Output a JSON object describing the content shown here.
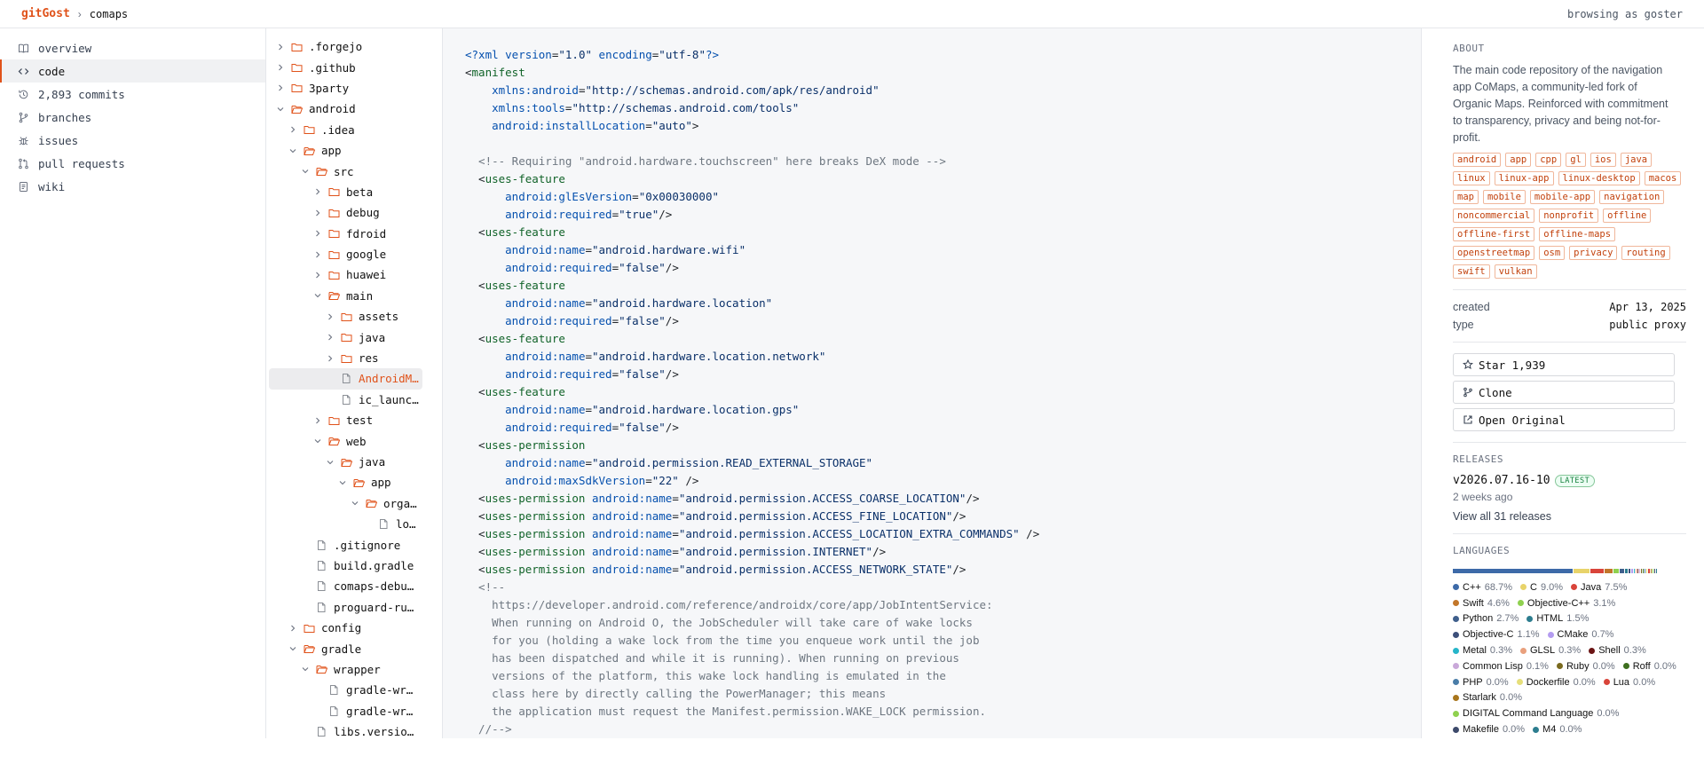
{
  "topbar": {
    "brand": "gitGost",
    "sep": "›",
    "repo": "comaps",
    "user": "browsing as goster"
  },
  "nav": [
    {
      "label": "overview",
      "icon": "book-icon"
    },
    {
      "label": "code",
      "icon": "code-icon",
      "active": true
    },
    {
      "label": "2,893 commits",
      "icon": "history-icon"
    },
    {
      "label": "branches",
      "icon": "branch-icon"
    },
    {
      "label": "issues",
      "icon": "bug-icon"
    },
    {
      "label": "pull requests",
      "icon": "pull-request-icon"
    },
    {
      "label": "wiki",
      "icon": "wiki-icon"
    }
  ],
  "tree": [
    {
      "name": ".forgejo",
      "type": "folder",
      "open": false,
      "depth": 0
    },
    {
      "name": ".github",
      "type": "folder",
      "open": false,
      "depth": 0
    },
    {
      "name": "3party",
      "type": "folder",
      "open": false,
      "depth": 0
    },
    {
      "name": "android",
      "type": "folder",
      "open": true,
      "depth": 0
    },
    {
      "name": ".idea",
      "type": "folder",
      "open": false,
      "depth": 1
    },
    {
      "name": "app",
      "type": "folder",
      "open": true,
      "depth": 1
    },
    {
      "name": "src",
      "type": "folder",
      "open": true,
      "depth": 2
    },
    {
      "name": "beta",
      "type": "folder",
      "open": false,
      "depth": 3
    },
    {
      "name": "debug",
      "type": "folder",
      "open": false,
      "depth": 3
    },
    {
      "name": "fdroid",
      "type": "folder",
      "open": false,
      "depth": 3
    },
    {
      "name": "google",
      "type": "folder",
      "open": false,
      "depth": 3
    },
    {
      "name": "huawei",
      "type": "folder",
      "open": false,
      "depth": 3
    },
    {
      "name": "main",
      "type": "folder",
      "open": true,
      "depth": 3
    },
    {
      "name": "assets",
      "type": "folder",
      "open": false,
      "depth": 4
    },
    {
      "name": "java",
      "type": "folder",
      "open": false,
      "depth": 4
    },
    {
      "name": "res",
      "type": "folder",
      "open": false,
      "depth": 4
    },
    {
      "name": "AndroidM…",
      "type": "file",
      "depth": 4,
      "selected": true
    },
    {
      "name": "ic_launc…",
      "type": "file",
      "depth": 4
    },
    {
      "name": "test",
      "type": "folder",
      "open": false,
      "depth": 3
    },
    {
      "name": "web",
      "type": "folder",
      "open": true,
      "depth": 3
    },
    {
      "name": "java",
      "type": "folder",
      "open": true,
      "depth": 4
    },
    {
      "name": "app",
      "type": "folder",
      "open": true,
      "depth": 5
    },
    {
      "name": "orga…",
      "type": "folder",
      "open": true,
      "depth": 6
    },
    {
      "name": "lo…",
      "type": "file",
      "depth": 7
    },
    {
      "name": ".gitignore",
      "type": "file",
      "depth": 2
    },
    {
      "name": "build.gradle",
      "type": "file",
      "depth": 2
    },
    {
      "name": "comaps-debu…",
      "type": "file",
      "depth": 2
    },
    {
      "name": "proguard-ru…",
      "type": "file",
      "depth": 2
    },
    {
      "name": "config",
      "type": "folder",
      "open": false,
      "depth": 1
    },
    {
      "name": "gradle",
      "type": "folder",
      "open": true,
      "depth": 1
    },
    {
      "name": "wrapper",
      "type": "folder",
      "open": true,
      "depth": 2
    },
    {
      "name": "gradle-wr…",
      "type": "file",
      "depth": 3
    },
    {
      "name": "gradle-wr…",
      "type": "file",
      "depth": 3
    },
    {
      "name": "libs.versio…",
      "type": "file",
      "depth": 2
    }
  ],
  "code": [
    [
      [
        "pi",
        "<?xml "
      ],
      [
        "attr",
        "version"
      ],
      [
        "",
        "="
      ],
      [
        "str",
        "\"1.0\""
      ],
      [
        "",
        " "
      ],
      [
        "attr",
        "encoding"
      ],
      [
        "",
        "="
      ],
      [
        "str",
        "\"utf-8\""
      ],
      [
        "pi",
        "?>"
      ]
    ],
    [
      [
        "",
        "<"
      ],
      [
        "tag",
        "manifest"
      ]
    ],
    [
      [
        "",
        "    "
      ],
      [
        "attr",
        "xmlns:android"
      ],
      [
        "",
        "="
      ],
      [
        "str",
        "\"http://schemas.android.com/apk/res/android\""
      ]
    ],
    [
      [
        "",
        "    "
      ],
      [
        "attr",
        "xmlns:tools"
      ],
      [
        "",
        "="
      ],
      [
        "str",
        "\"http://schemas.android.com/tools\""
      ]
    ],
    [
      [
        "",
        "    "
      ],
      [
        "attr",
        "android:installLocation"
      ],
      [
        "",
        "="
      ],
      [
        "str",
        "\"auto\""
      ],
      [
        "",
        ">"
      ]
    ],
    [
      [
        "",
        ""
      ]
    ],
    [
      [
        "com",
        "  <!-- Requiring \"android.hardware.touchscreen\" here breaks DeX mode -->"
      ]
    ],
    [
      [
        "",
        "  <"
      ],
      [
        "tag",
        "uses-feature"
      ]
    ],
    [
      [
        "",
        "      "
      ],
      [
        "attr",
        "android:glEsVersion"
      ],
      [
        "",
        "="
      ],
      [
        "str",
        "\"0x00030000\""
      ]
    ],
    [
      [
        "",
        "      "
      ],
      [
        "attr",
        "android:required"
      ],
      [
        "",
        "="
      ],
      [
        "str",
        "\"true\""
      ],
      [
        "",
        "/>"
      ]
    ],
    [
      [
        "",
        "  <"
      ],
      [
        "tag",
        "uses-feature"
      ]
    ],
    [
      [
        "",
        "      "
      ],
      [
        "attr",
        "android:name"
      ],
      [
        "",
        "="
      ],
      [
        "str",
        "\"android.hardware.wifi\""
      ]
    ],
    [
      [
        "",
        "      "
      ],
      [
        "attr",
        "android:required"
      ],
      [
        "",
        "="
      ],
      [
        "str",
        "\"false\""
      ],
      [
        "",
        "/>"
      ]
    ],
    [
      [
        "",
        "  <"
      ],
      [
        "tag",
        "uses-feature"
      ]
    ],
    [
      [
        "",
        "      "
      ],
      [
        "attr",
        "android:name"
      ],
      [
        "",
        "="
      ],
      [
        "str",
        "\"android.hardware.location\""
      ]
    ],
    [
      [
        "",
        "      "
      ],
      [
        "attr",
        "android:required"
      ],
      [
        "",
        "="
      ],
      [
        "str",
        "\"false\""
      ],
      [
        "",
        "/>"
      ]
    ],
    [
      [
        "",
        "  <"
      ],
      [
        "tag",
        "uses-feature"
      ]
    ],
    [
      [
        "",
        "      "
      ],
      [
        "attr",
        "android:name"
      ],
      [
        "",
        "="
      ],
      [
        "str",
        "\"android.hardware.location.network\""
      ]
    ],
    [
      [
        "",
        "      "
      ],
      [
        "attr",
        "android:required"
      ],
      [
        "",
        "="
      ],
      [
        "str",
        "\"false\""
      ],
      [
        "",
        "/>"
      ]
    ],
    [
      [
        "",
        "  <"
      ],
      [
        "tag",
        "uses-feature"
      ]
    ],
    [
      [
        "",
        "      "
      ],
      [
        "attr",
        "android:name"
      ],
      [
        "",
        "="
      ],
      [
        "str",
        "\"android.hardware.location.gps\""
      ]
    ],
    [
      [
        "",
        "      "
      ],
      [
        "attr",
        "android:required"
      ],
      [
        "",
        "="
      ],
      [
        "str",
        "\"false\""
      ],
      [
        "",
        "/>"
      ]
    ],
    [
      [
        "",
        "  <"
      ],
      [
        "tag",
        "uses-permission"
      ]
    ],
    [
      [
        "",
        "      "
      ],
      [
        "attr",
        "android:name"
      ],
      [
        "",
        "="
      ],
      [
        "str",
        "\"android.permission.READ_EXTERNAL_STORAGE\""
      ]
    ],
    [
      [
        "",
        "      "
      ],
      [
        "attr",
        "android:maxSdkVersion"
      ],
      [
        "",
        "="
      ],
      [
        "str",
        "\"22\""
      ],
      [
        "",
        " />"
      ]
    ],
    [
      [
        "",
        "  <"
      ],
      [
        "tag",
        "uses-permission"
      ],
      [
        "",
        " "
      ],
      [
        "attr",
        "android:name"
      ],
      [
        "",
        "="
      ],
      [
        "str",
        "\"android.permission.ACCESS_COARSE_LOCATION\""
      ],
      [
        "",
        "/>"
      ]
    ],
    [
      [
        "",
        "  <"
      ],
      [
        "tag",
        "uses-permission"
      ],
      [
        "",
        " "
      ],
      [
        "attr",
        "android:name"
      ],
      [
        "",
        "="
      ],
      [
        "str",
        "\"android.permission.ACCESS_FINE_LOCATION\""
      ],
      [
        "",
        "/>"
      ]
    ],
    [
      [
        "",
        "  <"
      ],
      [
        "tag",
        "uses-permission"
      ],
      [
        "",
        " "
      ],
      [
        "attr",
        "android:name"
      ],
      [
        "",
        "="
      ],
      [
        "str",
        "\"android.permission.ACCESS_LOCATION_EXTRA_COMMANDS\""
      ],
      [
        "",
        " />"
      ]
    ],
    [
      [
        "",
        "  <"
      ],
      [
        "tag",
        "uses-permission"
      ],
      [
        "",
        " "
      ],
      [
        "attr",
        "android:name"
      ],
      [
        "",
        "="
      ],
      [
        "str",
        "\"android.permission.INTERNET\""
      ],
      [
        "",
        "/>"
      ]
    ],
    [
      [
        "",
        "  <"
      ],
      [
        "tag",
        "uses-permission"
      ],
      [
        "",
        " "
      ],
      [
        "attr",
        "android:name"
      ],
      [
        "",
        "="
      ],
      [
        "str",
        "\"android.permission.ACCESS_NETWORK_STATE\""
      ],
      [
        "",
        "/>"
      ]
    ],
    [
      [
        "com",
        "  <!--"
      ]
    ],
    [
      [
        "com",
        "    https://developer.android.com/reference/androidx/core/app/JobIntentService:"
      ]
    ],
    [
      [
        "com",
        "    When running on Android O, the JobScheduler will take care of wake locks"
      ]
    ],
    [
      [
        "com",
        "    for you (holding a wake lock from the time you enqueue work until the job"
      ]
    ],
    [
      [
        "com",
        "    has been dispatched and while it is running). When running on previous"
      ]
    ],
    [
      [
        "com",
        "    versions of the platform, this wake lock handling is emulated in the"
      ]
    ],
    [
      [
        "com",
        "    class here by directly calling the PowerManager; this means"
      ]
    ],
    [
      [
        "com",
        "    the application must request the Manifest.permission.WAKE_LOCK permission."
      ]
    ],
    [
      [
        "com",
        "  //-->"
      ]
    ]
  ],
  "about": {
    "heading": "ABOUT",
    "description": "The main code repository of the navigation app CoMaps, a community-led fork of Organic Maps. Reinforced with commitment to transparency, privacy and being not-for-profit.",
    "topics": [
      "android",
      "app",
      "cpp",
      "gl",
      "ios",
      "java",
      "linux",
      "linux-app",
      "linux-desktop",
      "macos",
      "map",
      "mobile",
      "mobile-app",
      "navigation",
      "noncommercial",
      "nonprofit",
      "offline",
      "offline-first",
      "offline-maps",
      "openstreetmap",
      "osm",
      "privacy",
      "routing",
      "swift",
      "vulkan"
    ],
    "created_label": "created",
    "created_value": "Apr 13, 2025",
    "type_label": "type",
    "type_value": "public proxy"
  },
  "actions": {
    "star": "Star 1,939",
    "clone": "Clone",
    "open": "Open Original"
  },
  "releases": {
    "heading": "RELEASES",
    "latest_name": "v2026.07.16-10",
    "latest_badge": "LATEST",
    "latest_age": "2 weeks ago",
    "view_all": "View all 31 releases"
  },
  "languages": {
    "heading": "LANGUAGES",
    "items": [
      {
        "name": "C++",
        "pct": "68.7%",
        "value": 68.7,
        "color": "#3d6aa8"
      },
      {
        "name": "C",
        "pct": "9.0%",
        "value": 9.0,
        "color": "#e8d36a"
      },
      {
        "name": "Java",
        "pct": "7.5%",
        "value": 7.5,
        "color": "#d9443a"
      },
      {
        "name": "Swift",
        "pct": "4.6%",
        "value": 4.6,
        "color": "#c2762a"
      },
      {
        "name": "Objective-C++",
        "pct": "3.1%",
        "value": 3.1,
        "color": "#8fd14f"
      },
      {
        "name": "Python",
        "pct": "2.7%",
        "value": 2.7,
        "color": "#3f5f8c"
      },
      {
        "name": "HTML",
        "pct": "1.5%",
        "value": 1.5,
        "color": "#2d7d8f"
      },
      {
        "name": "Objective-C",
        "pct": "1.1%",
        "value": 1.1,
        "color": "#3c4f7a"
      },
      {
        "name": "CMake",
        "pct": "0.7%",
        "value": 0.7,
        "color": "#b49cf0"
      },
      {
        "name": "Metal",
        "pct": "0.3%",
        "value": 0.3,
        "color": "#26b5c9"
      },
      {
        "name": "GLSL",
        "pct": "0.3%",
        "value": 0.3,
        "color": "#e9a07d"
      },
      {
        "name": "Shell",
        "pct": "0.3%",
        "value": 0.3,
        "color": "#6b1414"
      },
      {
        "name": "Common Lisp",
        "pct": "0.1%",
        "value": 0.1,
        "color": "#c9a8d9"
      },
      {
        "name": "Ruby",
        "pct": "0.0%",
        "value": 0.0,
        "color": "#7a6a1e"
      },
      {
        "name": "Roff",
        "pct": "0.0%",
        "value": 0.0,
        "color": "#3d6e1e"
      },
      {
        "name": "PHP",
        "pct": "0.0%",
        "value": 0.0,
        "color": "#4a7da8"
      },
      {
        "name": "Dockerfile",
        "pct": "0.0%",
        "value": 0.0,
        "color": "#e6df7a"
      },
      {
        "name": "Lua",
        "pct": "0.0%",
        "value": 0.0,
        "color": "#d9443a"
      },
      {
        "name": "Starlark",
        "pct": "0.0%",
        "value": 0.0,
        "color": "#a8761c"
      },
      {
        "name": "DIGITAL Command Language",
        "pct": "0.0%",
        "value": 0.0,
        "color": "#8fd14f"
      },
      {
        "name": "Makefile",
        "pct": "0.0%",
        "value": 0.0,
        "color": "#3d4a6b"
      },
      {
        "name": "M4",
        "pct": "0.0%",
        "value": 0.0,
        "color": "#2d7d8f"
      }
    ]
  }
}
